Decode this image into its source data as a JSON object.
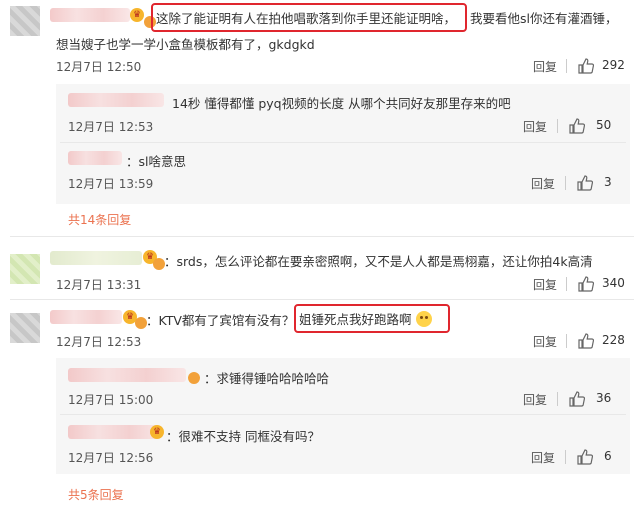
{
  "comments": [
    {
      "text1": "这除了能证明有人在拍他唱歌落到你手里还能证明啥，",
      "text2": "我要看他sl你还有灌酒锤，",
      "text3": "想当嫂子也学一学小盒鱼模板都有了，gkdgkd",
      "date": "12月7日",
      "time": "12:50",
      "reply": "回复",
      "likes": "292",
      "subs": [
        {
          "text": "14秒 懂得都懂 pyq视频的长度 从哪个共同好友那里存来的吧",
          "date": "12月7日",
          "time": "12:53",
          "reply": "回复",
          "likes": "50"
        },
        {
          "text": "：sl啥意思",
          "date": "12月7日",
          "time": "13:59",
          "reply": "回复",
          "likes": "3"
        }
      ],
      "more": "共14条回复"
    },
    {
      "text": "：srds，怎么评论都在要亲密照啊，又不是人人都是焉栩嘉，还让你拍4k高清",
      "date": "12月7日",
      "time": "13:31",
      "reply": "回复",
      "likes": "340"
    },
    {
      "text1": "：KTV都有了宾馆有没有？",
      "text2": "姐锤死点我好跑路啊",
      "date": "12月7日",
      "time": "12:53",
      "reply": "回复",
      "likes": "228",
      "subs": [
        {
          "text": "：求锤得锤哈哈哈哈哈",
          "date": "12月7日",
          "time": "15:00",
          "reply": "回复",
          "likes": "36"
        },
        {
          "text": "：很难不支持 同框没有吗？",
          "date": "12月7日",
          "time": "12:56",
          "reply": "回复",
          "likes": "6"
        }
      ],
      "more": "共5条回复"
    }
  ],
  "colors": {
    "highlight": "#e0262e",
    "more_link": "#eb7350",
    "subpanel": "#f6f6f6"
  },
  "icons": {
    "like": "thumb-up-icon",
    "badge": "vip-badge-icon"
  }
}
